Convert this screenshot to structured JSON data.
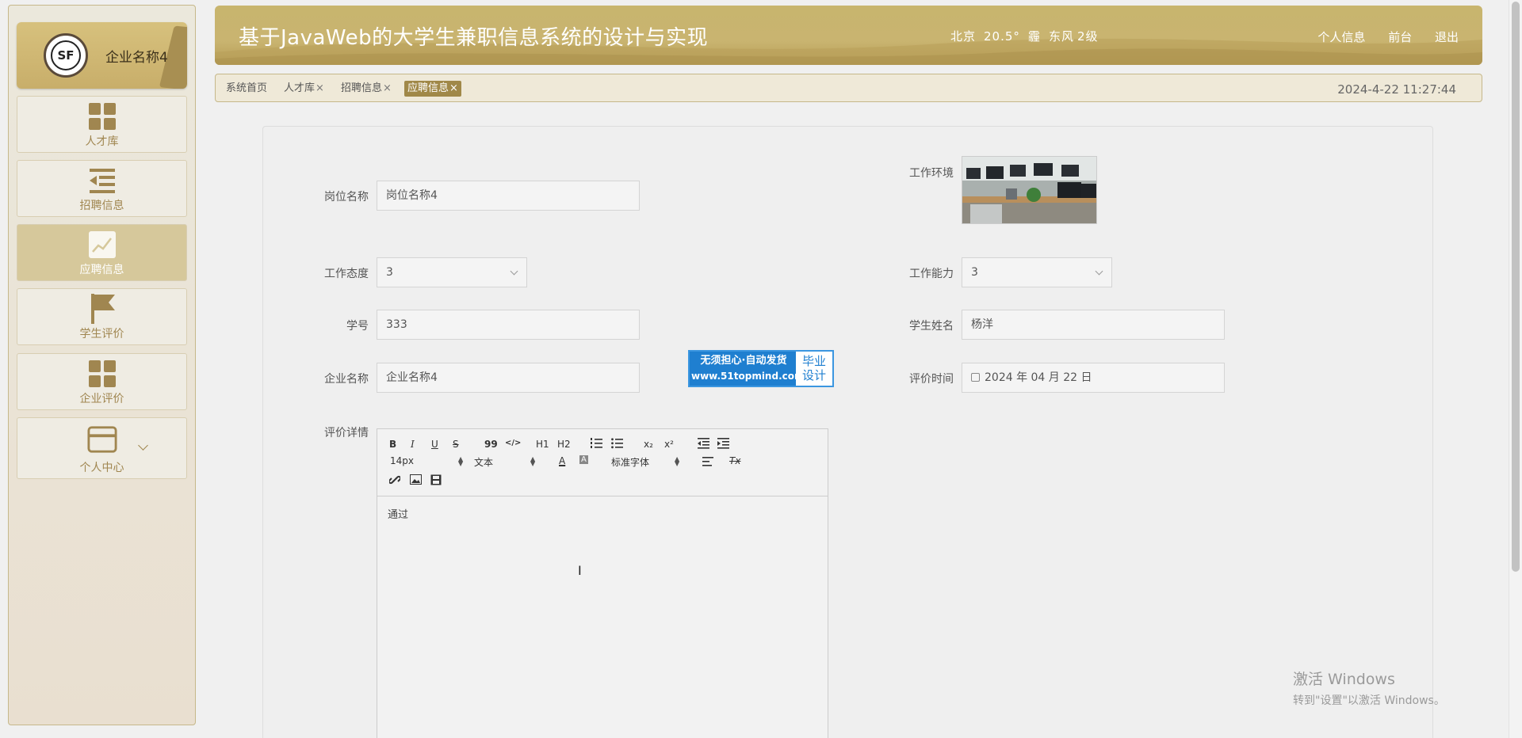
{
  "sidebar": {
    "company_name": "企业名称4",
    "logo_text": "SF",
    "items": [
      {
        "label": "人才库",
        "icon": "grid-icon"
      },
      {
        "label": "招聘信息",
        "icon": "list-indent-icon"
      },
      {
        "label": "应聘信息",
        "icon": "chart-line-icon",
        "active": true
      },
      {
        "label": "学生评价",
        "icon": "flag-icon"
      },
      {
        "label": "企业评价",
        "icon": "grid-icon"
      },
      {
        "label": "个人中心",
        "icon": "card-icon"
      }
    ]
  },
  "header": {
    "title": "基于JavaWeb的大学生兼职信息系统的设计与实现",
    "weather": {
      "city": "北京",
      "temp": "20.5°",
      "condition": "霾",
      "wind": "东风",
      "level": "2级"
    },
    "links": {
      "profile": "个人信息",
      "frontend": "前台",
      "logout": "退出"
    }
  },
  "tabs": [
    {
      "label": "系统首页",
      "closable": false
    },
    {
      "label": "人才库",
      "closable": true
    },
    {
      "label": "招聘信息",
      "closable": true
    },
    {
      "label": "应聘信息",
      "closable": true,
      "active": true
    }
  ],
  "close_glyph": "×",
  "datetime": "2024-4-22 11:27:44",
  "form": {
    "position_name": {
      "label": "岗位名称",
      "value": "岗位名称4"
    },
    "work_env": {
      "label": "工作环境"
    },
    "work_attitude": {
      "label": "工作态度",
      "value": "3"
    },
    "work_ability": {
      "label": "工作能力",
      "value": "3"
    },
    "student_id": {
      "label": "学号",
      "value": "333"
    },
    "student_name": {
      "label": "学生姓名",
      "value": "杨洋"
    },
    "company_name": {
      "label": "企业名称",
      "value": "企业名称4"
    },
    "eval_time": {
      "label": "评价时间",
      "value": "2024 年 04 月 22 日"
    },
    "eval_detail": {
      "label": "评价详情",
      "content": "通过"
    }
  },
  "editor_toolbar": {
    "bold": "B",
    "italic": "I",
    "underline": "U",
    "strike": "S",
    "quote": "99",
    "code": "</>",
    "h1": "H1",
    "h2": "H2",
    "subscript": "x₂",
    "superscript": "x²",
    "font_size": "14px",
    "text_type": "文本",
    "font_family": "标准字体",
    "clear_format": "Tx"
  },
  "ad": {
    "line1": "无须担心·自动发货",
    "line2": "www.51topmind.com",
    "side1": "毕业",
    "side2": "设计"
  },
  "activation": {
    "line1": "激活 Windows",
    "line2": "转到\"设置\"以激活 Windows。"
  },
  "colors": {
    "accent": "#c8b56e",
    "active_tab": "#a08848",
    "sidebar_text": "#a08650"
  }
}
